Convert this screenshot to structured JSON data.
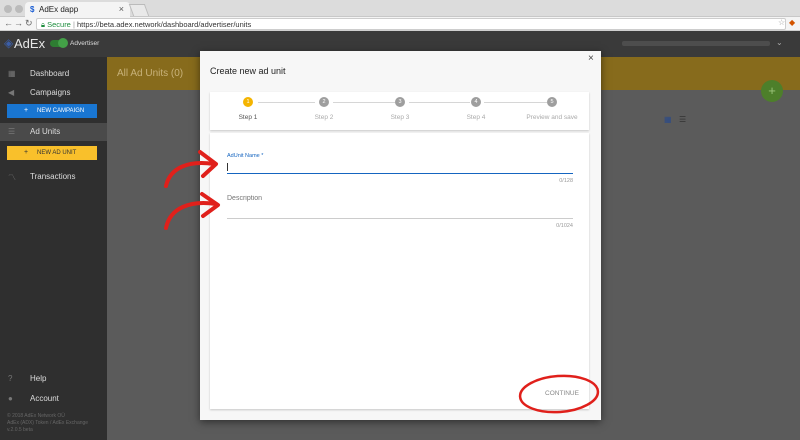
{
  "browser": {
    "tab_title": "AdEx dapp",
    "tab_favicon": "$",
    "secure_label": "Secure",
    "url": "https://beta.adex.network/dashboard/advertiser/units"
  },
  "app": {
    "logo": "AdEx",
    "role": "Advertiser"
  },
  "sidebar": {
    "items": [
      {
        "label": "Dashboard",
        "icon": "grid-icon"
      },
      {
        "label": "Campaigns",
        "icon": "megaphone-icon"
      },
      {
        "label": "Ad Units",
        "icon": "list-icon"
      },
      {
        "label": "Transactions",
        "icon": "chart-icon"
      },
      {
        "label": "Help",
        "icon": "help-icon"
      },
      {
        "label": "Account",
        "icon": "account-icon"
      }
    ],
    "new_campaign": "NEW CAMPAIGN",
    "new_unit": "NEW AD UNIT",
    "footer": [
      "© 2018 AdEx Network OÜ",
      "AdEx (ADX) Token / AdEx Exchange",
      "v.2.0.5 beta"
    ]
  },
  "main": {
    "title": "All Ad Units (0)",
    "fab": "+"
  },
  "modal": {
    "title": "Create new ad unit",
    "close": "×",
    "steps": [
      {
        "num": "1",
        "label": "Step 1"
      },
      {
        "num": "2",
        "label": "Step 2"
      },
      {
        "num": "3",
        "label": "Step 3"
      },
      {
        "num": "4",
        "label": "Step 4"
      },
      {
        "num": "5",
        "label": "Preview and save"
      }
    ],
    "name_label": "AdUnit Name *",
    "name_value": "",
    "name_counter": "0/128",
    "desc_placeholder": "Description",
    "desc_counter": "0/1024",
    "continue": "CONTINUE"
  },
  "colors": {
    "accent_yellow": "#f4b400",
    "accent_blue": "#1565c0",
    "annotation_red": "#e0201b"
  }
}
